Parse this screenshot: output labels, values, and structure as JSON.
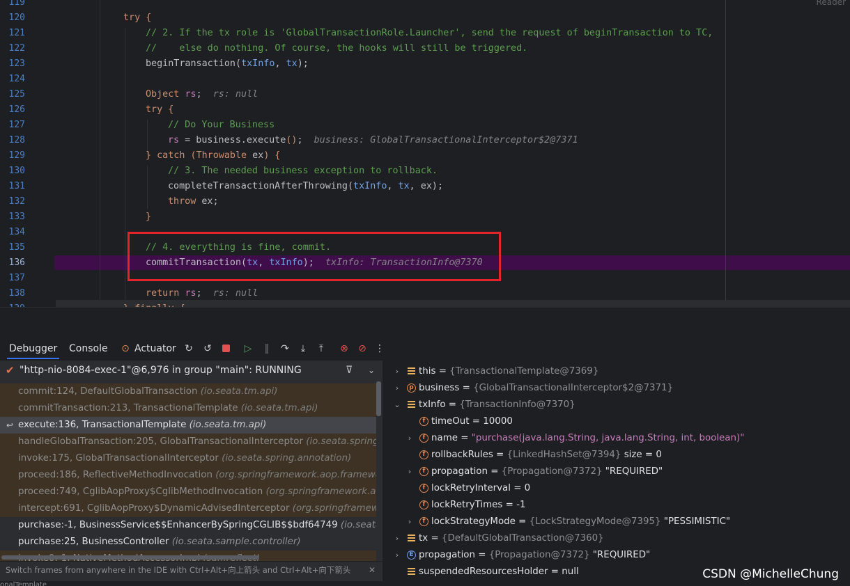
{
  "editor": {
    "reader_mode": "Reader",
    "lines": [
      {
        "n": "119",
        "parts": []
      },
      {
        "n": "120",
        "parts": [
          {
            "c": "kw",
            "t": "try"
          },
          {
            "c": "pl",
            "t": " "
          },
          {
            "c": "kw",
            "t": "{"
          }
        ]
      },
      {
        "n": "121",
        "parts": [
          {
            "c": "cm",
            "t": "// 2. If the tx role is 'GlobalTransactionRole.Launcher', send the request of beginTransaction to TC,"
          }
        ]
      },
      {
        "n": "122",
        "parts": [
          {
            "c": "cm",
            "t": "//    else do nothing. Of course, the hooks will still be triggered."
          }
        ]
      },
      {
        "n": "123",
        "parts": [
          {
            "c": "pl",
            "t": "beginTransaction("
          },
          {
            "c": "par",
            "t": "txInfo"
          },
          {
            "c": "pl",
            "t": ", "
          },
          {
            "c": "par",
            "t": "tx"
          },
          {
            "c": "pl",
            "t": ");"
          }
        ]
      },
      {
        "n": "124",
        "parts": []
      },
      {
        "n": "125",
        "parts": [
          {
            "c": "kw",
            "t": "Object "
          },
          {
            "c": "fld",
            "t": "rs"
          },
          {
            "c": "pl",
            "t": ";  "
          },
          {
            "c": "hint",
            "t": "rs: null"
          }
        ]
      },
      {
        "n": "126",
        "parts": [
          {
            "c": "kw",
            "t": "try"
          },
          {
            "c": "pl",
            "t": " "
          },
          {
            "c": "kw",
            "t": "{"
          }
        ]
      },
      {
        "n": "127",
        "parts": [
          {
            "c": "cm",
            "t": "// Do Your Business"
          }
        ]
      },
      {
        "n": "128",
        "parts": [
          {
            "c": "fld",
            "t": "rs"
          },
          {
            "c": "pl",
            "t": " = business.execute"
          },
          {
            "c": "kw",
            "t": "()"
          },
          {
            "c": "pl",
            "t": ";  "
          },
          {
            "c": "hint",
            "t": "business: GlobalTransactionalInterceptor$2@7371"
          }
        ]
      },
      {
        "n": "129",
        "parts": [
          {
            "c": "kw",
            "t": "} catch ("
          },
          {
            "c": "kw",
            "t": "Throwable"
          },
          {
            "c": "pl",
            "t": " ex"
          },
          {
            "c": "kw",
            "t": ") {"
          }
        ]
      },
      {
        "n": "130",
        "parts": [
          {
            "c": "cm",
            "t": "// 3. The needed business exception to rollback."
          }
        ]
      },
      {
        "n": "131",
        "parts": [
          {
            "c": "pl",
            "t": "completeTransactionAfterThrowing("
          },
          {
            "c": "par",
            "t": "txInfo"
          },
          {
            "c": "pl",
            "t": ", "
          },
          {
            "c": "par",
            "t": "tx"
          },
          {
            "c": "pl",
            "t": ", ex);"
          }
        ]
      },
      {
        "n": "132",
        "parts": [
          {
            "c": "kw",
            "t": "throw"
          },
          {
            "c": "pl",
            "t": " ex;"
          }
        ]
      },
      {
        "n": "133",
        "parts": [
          {
            "c": "kw",
            "t": "}"
          }
        ]
      },
      {
        "n": "134",
        "parts": []
      },
      {
        "n": "135",
        "parts": [
          {
            "c": "cm",
            "t": "// 4. everything is fine, commit."
          }
        ]
      },
      {
        "n": "136",
        "parts": [
          {
            "c": "pl",
            "t": "commitTransaction("
          },
          {
            "c": "par",
            "t": "tx"
          },
          {
            "c": "pl",
            "t": ", "
          },
          {
            "c": "par",
            "t": "txInfo"
          },
          {
            "c": "pl",
            "t": ");  "
          },
          {
            "c": "hint",
            "t": "txInfo: TransactionInfo@7370"
          }
        ]
      },
      {
        "n": "137",
        "parts": []
      },
      {
        "n": "138",
        "parts": [
          {
            "c": "kw",
            "t": "return "
          },
          {
            "c": "fld",
            "t": "rs"
          },
          {
            "c": "pl",
            "t": ";  "
          },
          {
            "c": "hint",
            "t": "rs: null"
          }
        ]
      },
      {
        "n": "139",
        "parts": [
          {
            "c": "kw",
            "t": "} finally {"
          }
        ]
      }
    ]
  },
  "debug_tabs": {
    "debugger": "Debugger",
    "console": "Console",
    "actuator": "Actuator"
  },
  "thread": {
    "label": "\"http-nio-8084-exec-1\"@6,976 in group \"main\": RUNNING"
  },
  "frames": [
    {
      "kind": "lib",
      "method": "commit:124, DefaultGlobalTransaction ",
      "pkg": "(io.seata.tm.api)"
    },
    {
      "kind": "lib",
      "method": "commitTransaction:213, TransactionalTemplate ",
      "pkg": "(io.seata.tm.api)"
    },
    {
      "kind": "selected",
      "method": "execute:136, TransactionalTemplate ",
      "pkg": "(io.seata.tm.api)"
    },
    {
      "kind": "lib",
      "method": "handleGlobalTransaction:205, GlobalTransactionalInterceptor ",
      "pkg": "(io.seata.spring.annotat"
    },
    {
      "kind": "lib",
      "method": "invoke:175, GlobalTransactionalInterceptor ",
      "pkg": "(io.seata.spring.annotation)"
    },
    {
      "kind": "lib",
      "method": "proceed:186, ReflectiveMethodInvocation ",
      "pkg": "(org.springframework.aop.framework)"
    },
    {
      "kind": "lib",
      "method": "proceed:749, CglibAopProxy$CglibMethodInvocation ",
      "pkg": "(org.springframework.aop.fram"
    },
    {
      "kind": "lib",
      "method": "intercept:691, CglibAopProxy$DynamicAdvisedInterceptor ",
      "pkg": "(org.springframework.aop"
    },
    {
      "kind": "user",
      "method": "purchase:-1, BusinessService$$EnhancerBySpringCGLIB$$bdf64749 ",
      "pkg": "(io.seata.sample."
    },
    {
      "kind": "user",
      "method": "purchase:25, BusinessController ",
      "pkg": "(io.seata.sample.controller)"
    },
    {
      "kind": "lib",
      "method": "invoke0:-1, NativeMethodAccessorImpl ",
      "pkg": "(sun.reflect)"
    }
  ],
  "frames_hint": "Switch frames from anywhere in the IDE with Ctrl+Alt+向上箭头 and Ctrl+Alt+向下箭头",
  "variables": [
    {
      "depth": 0,
      "arrow": "›",
      "icon": "list",
      "name": "this",
      "value": "{TransactionalTemplate@7369}",
      "extra": ""
    },
    {
      "depth": 0,
      "arrow": "›",
      "icon": "p",
      "name": "business",
      "value": "{GlobalTransactionalInterceptor$2@7371}",
      "extra": ""
    },
    {
      "depth": 0,
      "arrow": "⌄",
      "icon": "list",
      "name": "txInfo",
      "value": "{TransactionInfo@7370}",
      "extra": ""
    },
    {
      "depth": 1,
      "arrow": "",
      "icon": "f",
      "name": "timeOut",
      "value": "",
      "extra": "10000"
    },
    {
      "depth": 1,
      "arrow": "›",
      "icon": "f",
      "name": "name",
      "value": "",
      "str": "\"purchase(java.lang.String, java.lang.String, int, boolean)\""
    },
    {
      "depth": 1,
      "arrow": "",
      "icon": "f",
      "name": "rollbackRules",
      "value": "{LinkedHashSet@7394}",
      "extra": " size = 0"
    },
    {
      "depth": 1,
      "arrow": "›",
      "icon": "f",
      "name": "propagation",
      "value": "{Propagation@7372}",
      "extra": " \"REQUIRED\""
    },
    {
      "depth": 1,
      "arrow": "",
      "icon": "f",
      "name": "lockRetryInterval",
      "value": "",
      "extra": "0"
    },
    {
      "depth": 1,
      "arrow": "",
      "icon": "f",
      "name": "lockRetryTimes",
      "value": "",
      "extra": "-1"
    },
    {
      "depth": 1,
      "arrow": "›",
      "icon": "f",
      "name": "lockStrategyMode",
      "value": "{LockStrategyMode@7395}",
      "extra": " \"PESSIMISTIC\""
    },
    {
      "depth": 0,
      "arrow": "›",
      "icon": "list",
      "name": "tx",
      "value": "{DefaultGlobalTransaction@7360}",
      "extra": ""
    },
    {
      "depth": 0,
      "arrow": "›",
      "icon": "e",
      "name": "propagation",
      "value": "{Propagation@7372}",
      "extra": " \"REQUIRED\""
    },
    {
      "depth": 0,
      "arrow": "",
      "icon": "list",
      "name": "suspendedResourcesHolder",
      "value": "",
      "extra": "null"
    }
  ],
  "watermark": "CSDN @MichelleChung",
  "bottom_strip": "onalTemplate",
  "colors": {
    "exec_line": "#3f0d4a",
    "highlight_box": "#e3242b",
    "accent": "#3574f0"
  }
}
